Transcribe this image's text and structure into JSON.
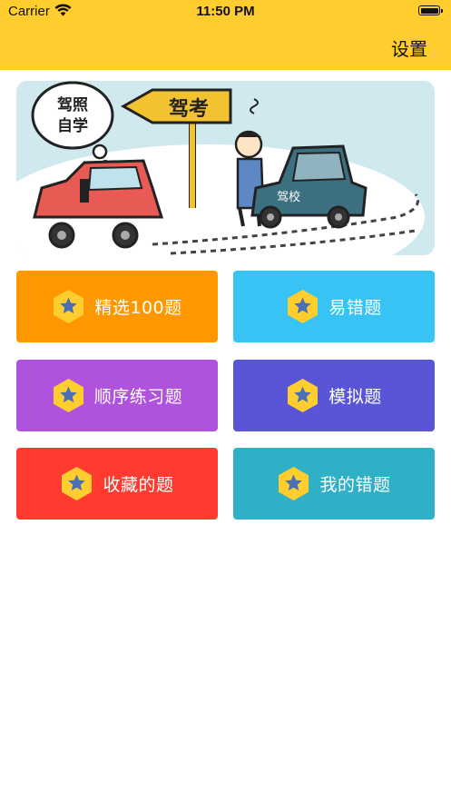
{
  "status_bar": {
    "carrier": "Carrier",
    "time": "11:50 PM"
  },
  "nav": {
    "settings_label": "设置"
  },
  "banner": {
    "bubble_text_line1": "驾照",
    "bubble_text_line2": "自学",
    "sign_text": "驾考",
    "car_door_text": "驾校"
  },
  "menu": [
    {
      "label": "精选100题",
      "color": "#FF9800"
    },
    {
      "label": "易错题",
      "color": "#37C4F5"
    },
    {
      "label": "顺序练习题",
      "color": "#AF52DE"
    },
    {
      "label": "模拟题",
      "color": "#5856D6"
    },
    {
      "label": "收藏的题",
      "color": "#FF3B30"
    },
    {
      "label": "我的错题",
      "color": "#30B0C7"
    }
  ],
  "icons": {
    "tile_icon": "star-hexagon-icon"
  },
  "colors": {
    "header": "#FFCE2E",
    "icon_hex": "#FFCE2E",
    "icon_star": "#4A6FB5"
  }
}
